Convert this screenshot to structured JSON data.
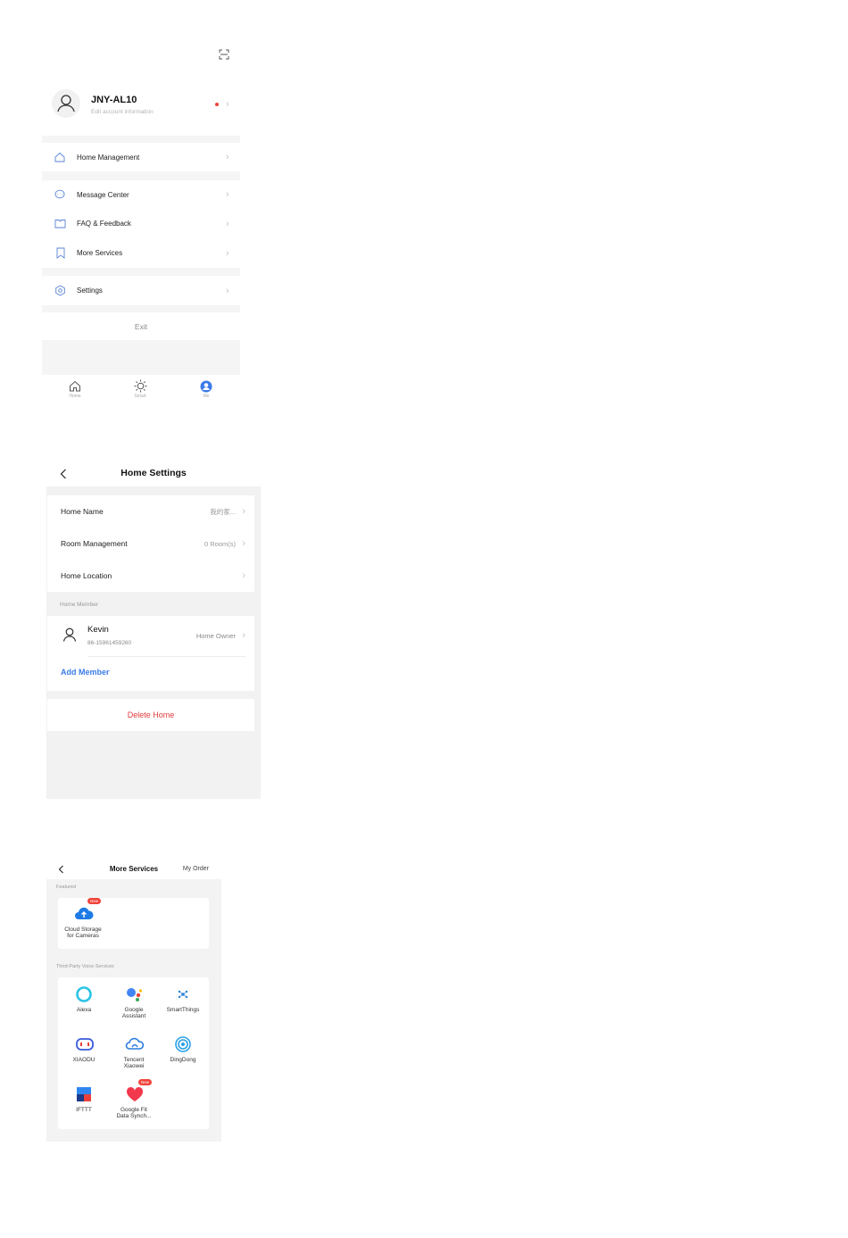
{
  "account_screen": {
    "username": "JNY-AL10",
    "subtitle": "Edit account information",
    "menu": {
      "home_management": "Home Management",
      "message_center": "Message Center",
      "faq_feedback": "FAQ & Feedback",
      "more_services": "More Services",
      "settings": "Settings"
    },
    "exit_label": "Exit",
    "tabbar": {
      "home": "Home",
      "smart": "Smart",
      "me": "Me"
    },
    "accent_color": "#3b7be8",
    "dot_color": "#f0433a"
  },
  "home_settings_screen": {
    "title": "Home Settings",
    "home_name_label": "Home Name",
    "home_name_value": "我的家...",
    "room_management_label": "Room Management",
    "room_management_value": "0 Room(s)",
    "home_location_label": "Home Location",
    "section_home_member": "Home Member",
    "member_name": "Kevin",
    "member_phone": "86-15961459260",
    "member_role": "Home Owner",
    "add_member_label": "Add Member",
    "delete_home_label": "Delete Home",
    "link_color": "#3b7be8",
    "danger_color": "#e23b3b"
  },
  "more_services_screen": {
    "title": "More Services",
    "my_order_label": "My Order",
    "section_featured": "Featured",
    "featured": [
      {
        "line1": "Cloud Storage",
        "line2": "for Cameras",
        "badge": "New"
      }
    ],
    "section_voice": "Third-Party Voice Services",
    "voice_services": [
      {
        "line1": "Alexa",
        "line2": ""
      },
      {
        "line1": "Google",
        "line2": "Assistant"
      },
      {
        "line1": "SmartThings",
        "line2": ""
      },
      {
        "line1": "XIAODU",
        "line2": ""
      },
      {
        "line1": "Tencent",
        "line2": "Xiaowei"
      },
      {
        "line1": "DingDong",
        "line2": ""
      },
      {
        "line1": "IFTTT",
        "line2": ""
      },
      {
        "line1": "Google Fit",
        "line2": "Data Synch...",
        "badge": "New"
      }
    ]
  }
}
